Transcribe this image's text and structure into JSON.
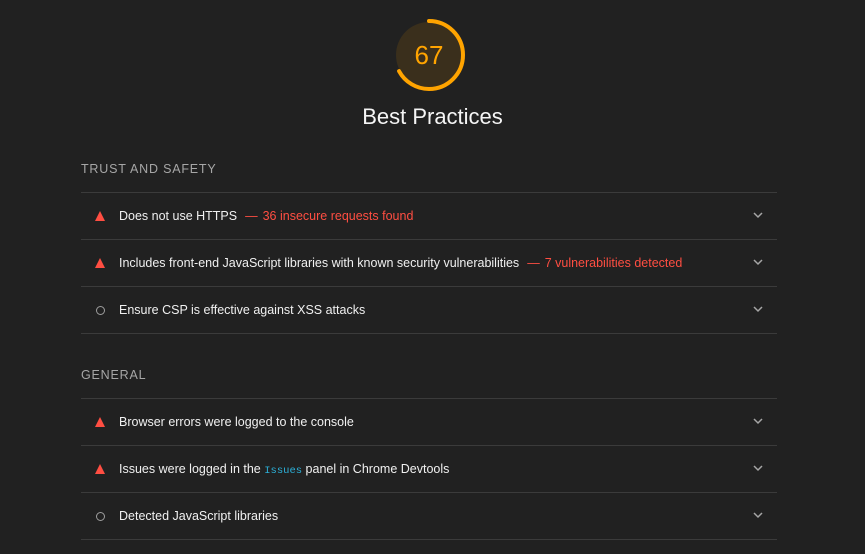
{
  "category": {
    "score": "67",
    "score_fraction": 0.67,
    "title": "Best Practices",
    "score_color": "#ffa400",
    "fail_color": "#ff4e42"
  },
  "groups": [
    {
      "title": "TRUST AND SAFETY",
      "audits": [
        {
          "status": "fail",
          "icon": "warning-triangle-icon",
          "title": "Does not use HTTPS",
          "separator": "—",
          "display": "36 insecure requests found"
        },
        {
          "status": "fail",
          "icon": "warning-triangle-icon",
          "title": "Includes front-end JavaScript libraries with known security vulnerabilities",
          "separator": "—",
          "display": "7 vulnerabilities detected"
        },
        {
          "status": "info",
          "icon": "info-circle-icon",
          "title": "Ensure CSP is effective against XSS attacks"
        }
      ]
    },
    {
      "title": "GENERAL",
      "audits": [
        {
          "status": "fail",
          "icon": "warning-triangle-icon",
          "title": "Browser errors were logged to the console"
        },
        {
          "status": "fail",
          "icon": "warning-triangle-icon",
          "title_prefix": "Issues were logged in the",
          "title_code": "Issues",
          "title_suffix": "panel in Chrome Devtools"
        },
        {
          "status": "info",
          "icon": "info-circle-icon",
          "title": "Detected JavaScript libraries"
        }
      ]
    }
  ]
}
